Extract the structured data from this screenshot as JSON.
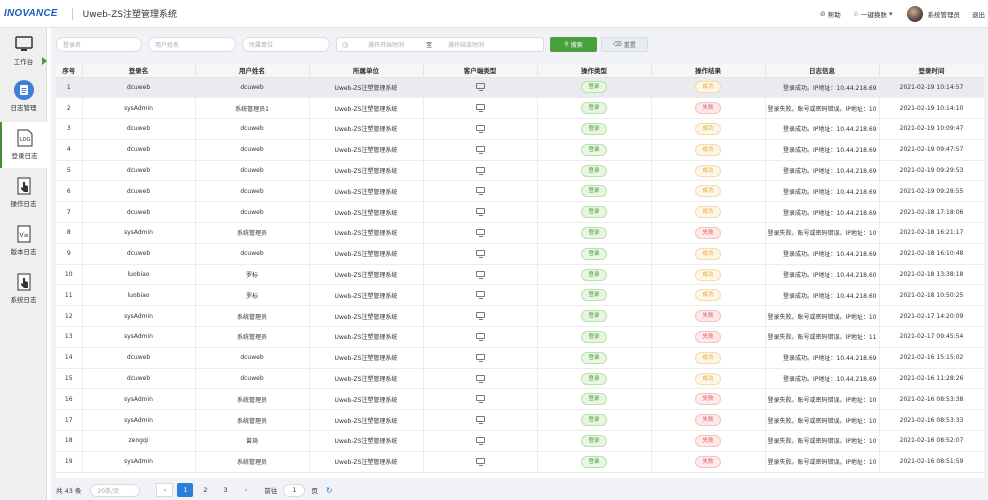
{
  "header": {
    "logo": "INOVANCE",
    "title": "Uweb-ZS注塑管理系统",
    "help": "帮助",
    "skin": "一键换肤",
    "user": "系统管理员",
    "logout": "退出"
  },
  "sidebar": {
    "items": [
      {
        "label": "工作台",
        "icon": "monitor-icon"
      },
      {
        "label": "日志管理",
        "icon": "document-icon"
      },
      {
        "label": "登录日志",
        "icon": "log-icon"
      },
      {
        "label": "操作日志",
        "icon": "hand-pointer-icon"
      },
      {
        "label": "版本日志",
        "icon": "version-icon"
      },
      {
        "label": "系统日志",
        "icon": "hand-pointer-icon"
      }
    ]
  },
  "filter": {
    "login_name_ph": "登录名",
    "user_name_ph": "用户姓名",
    "unit_ph": "所属单位",
    "start_ph": "操作开始时间",
    "to": "至",
    "end_ph": "操作结束时间",
    "search_label": "搜索",
    "reset_label": "重置"
  },
  "table": {
    "headers": [
      "序号",
      "登录名",
      "用户姓名",
      "所属单位",
      "客户端类型",
      "操作类型",
      "操作结果",
      "日志信息",
      "登录时间"
    ],
    "rows": [
      [
        "1",
        "dcuweb",
        "dcuweb",
        "Uweb-ZS注塑管理系统",
        "",
        "登录",
        "成功",
        "登录成功。IP地址：10.44.218.69",
        "2021-02-19 10:14:57"
      ],
      [
        "2",
        "sysAdmin",
        "系统管理员1",
        "Uweb-ZS注塑管理系统",
        "",
        "登录",
        "失败",
        "登录失败。账号或密码错误。IP地址：10",
        "2021-02-19 10:14:10"
      ],
      [
        "3",
        "dcuweb",
        "dcuweb",
        "Uweb-ZS注塑管理系统",
        "",
        "登录",
        "成功",
        "登录成功。IP地址：10.44.218.69",
        "2021-02-19 10:09:47"
      ],
      [
        "4",
        "dcuweb",
        "dcuweb",
        "Uweb-ZS注塑管理系统",
        "",
        "登录",
        "成功",
        "登录成功。IP地址：10.44.218.69",
        "2021-02-19 09:47:57"
      ],
      [
        "5",
        "dcuweb",
        "dcuweb",
        "Uweb-ZS注塑管理系统",
        "",
        "登录",
        "成功",
        "登录成功。IP地址：10.44.218.69",
        "2021-02-19 09:29:53"
      ],
      [
        "6",
        "dcuweb",
        "dcuweb",
        "Uweb-ZS注塑管理系统",
        "",
        "登录",
        "成功",
        "登录成功。IP地址：10.44.218.69",
        "2021-02-19 09:28:55"
      ],
      [
        "7",
        "dcuweb",
        "dcuweb",
        "Uweb-ZS注塑管理系统",
        "",
        "登录",
        "成功",
        "登录成功。IP地址：10.44.218.69",
        "2021-02-18 17:18:06"
      ],
      [
        "8",
        "sysAdmin",
        "系统管理员",
        "Uweb-ZS注塑管理系统",
        "",
        "登录",
        "失败",
        "登录失败。账号或密码错误。IP地址：10",
        "2021-02-18 16:21:17"
      ],
      [
        "9",
        "dcuweb",
        "dcuweb",
        "Uweb-ZS注塑管理系统",
        "",
        "登录",
        "成功",
        "登录成功。IP地址：10.44.218.69",
        "2021-02-18 16:10:48"
      ],
      [
        "10",
        "luobiao",
        "罗标",
        "Uweb-ZS注塑管理系统",
        "",
        "登录",
        "成功",
        "登录成功。IP地址：10.44.218.60",
        "2021-02-18 13:38:18"
      ],
      [
        "11",
        "luobiao",
        "罗标",
        "Uweb-ZS注塑管理系统",
        "",
        "登录",
        "成功",
        "登录成功。IP地址：10.44.218.60",
        "2021-02-18 10:50:25"
      ],
      [
        "12",
        "sysAdmin",
        "系统管理员",
        "Uweb-ZS注塑管理系统",
        "",
        "登录",
        "失败",
        "登录失败。账号或密码错误。IP地址：10",
        "2021-02-17 14:20:09"
      ],
      [
        "13",
        "sysAdmin",
        "系统管理员",
        "Uweb-ZS注塑管理系统",
        "",
        "登录",
        "失败",
        "登录失败。账号或密码错误。IP地址：11",
        "2021-02-17 09:45:54"
      ],
      [
        "14",
        "dcuweb",
        "dcuweb",
        "Uweb-ZS注塑管理系统",
        "",
        "登录",
        "成功",
        "登录成功。IP地址：10.44.218.69",
        "2021-02-16 15:15:02"
      ],
      [
        "15",
        "dcuweb",
        "dcuweb",
        "Uweb-ZS注塑管理系统",
        "",
        "登录",
        "成功",
        "登录成功。IP地址：10.44.218.69",
        "2021-02-16 11:28:26"
      ],
      [
        "16",
        "sysAdmin",
        "系统管理员",
        "Uweb-ZS注塑管理系统",
        "",
        "登录",
        "失败",
        "登录失败。账号或密码错误。IP地址：10",
        "2021-02-16 08:53:38"
      ],
      [
        "17",
        "sysAdmin",
        "系统管理员",
        "Uweb-ZS注塑管理系统",
        "",
        "登录",
        "失败",
        "登录失败。账号或密码错误。IP地址：10",
        "2021-02-16 08:53:33"
      ],
      [
        "18",
        "zengqi",
        "曾琦",
        "Uweb-ZS注塑管理系统",
        "",
        "登录",
        "失败",
        "登录失败。账号或密码错误。IP地址：10",
        "2021-02-16 08:52:07"
      ],
      [
        "19",
        "sysAdmin",
        "系统管理员",
        "Uweb-ZS注塑管理系统",
        "",
        "登录",
        "失败",
        "登录失败。账号或密码错误。IP地址：10",
        "2021-02-16 08:51:59"
      ]
    ]
  },
  "pager": {
    "total": "共 43 条",
    "page_size": "20条/页",
    "pages": [
      "1",
      "2",
      "3"
    ],
    "current": "1",
    "goto": "前往",
    "goto_value": "1",
    "page_unit": "页"
  },
  "colors": {
    "accent": "#4aa13b",
    "primary": "#2c7fd6",
    "fail": "#e15656",
    "success": "#e3a82f"
  }
}
